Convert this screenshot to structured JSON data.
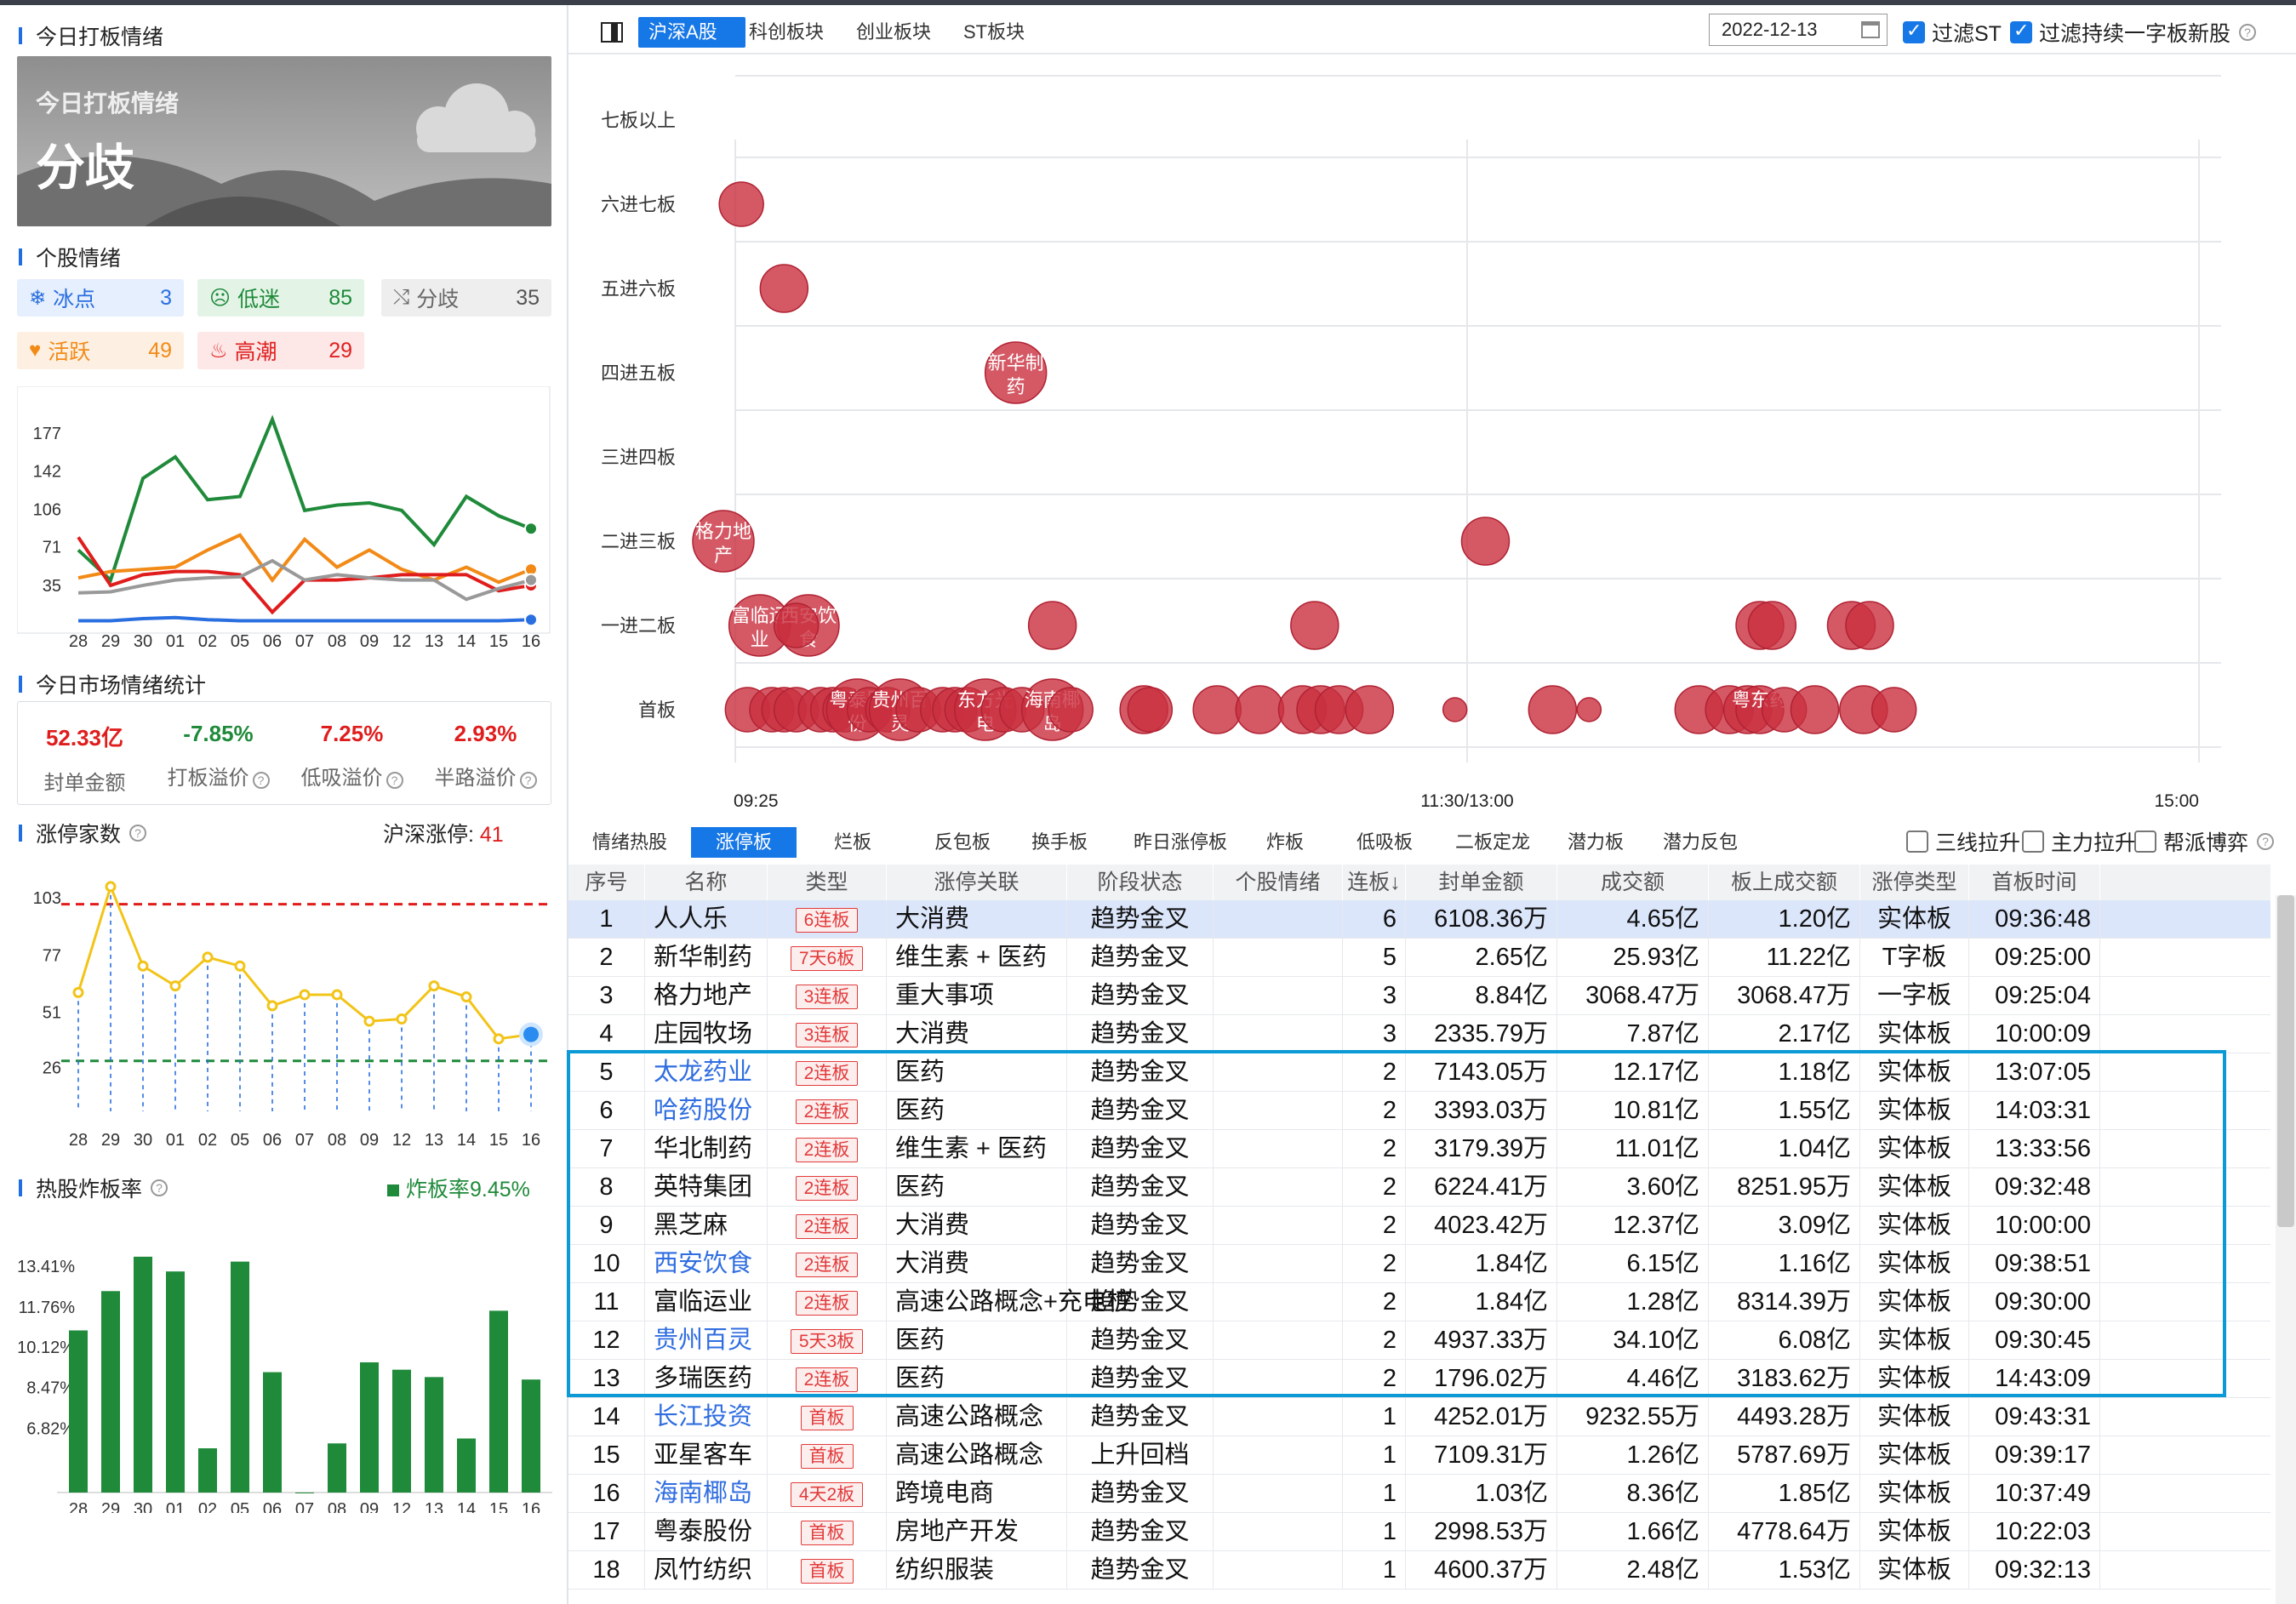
{
  "left": {
    "today_title": "今日打板情绪",
    "banner": {
      "subtitle": "今日打板情绪",
      "mood": "分歧"
    },
    "stock_mood_title": "个股情绪",
    "chips": [
      {
        "name": "冰点",
        "value": "3",
        "color": "#2a6fe0",
        "bg": "#e6effd",
        "icon": "snowflake-icon",
        "glyph": "❄"
      },
      {
        "name": "低迷",
        "value": "85",
        "color": "#1f8a3a",
        "bg": "#e3f4e7",
        "icon": "sad-face-icon",
        "glyph": "☹"
      },
      {
        "name": "分歧",
        "value": "35",
        "color": "#666",
        "bg": "#eeeeee",
        "icon": "share-icon",
        "glyph": "⤭"
      },
      {
        "name": "活跃",
        "value": "49",
        "color": "#f28a17",
        "bg": "#fdf0e2",
        "icon": "heart-icon",
        "glyph": "♥"
      },
      {
        "name": "高潮",
        "value": "29",
        "color": "#e02020",
        "bg": "#fde7e7",
        "icon": "fire-icon",
        "glyph": "♨"
      }
    ],
    "market_stats_title": "今日市场情绪统计",
    "stats": [
      {
        "value": "52.33亿",
        "label": "封单金额",
        "color": "#e01d1d",
        "hint": false
      },
      {
        "value": "-7.85%",
        "label": "打板溢价",
        "color": "#1f8a3a",
        "hint": true
      },
      {
        "value": "7.25%",
        "label": "低吸溢价",
        "color": "#e01d1d",
        "hint": true
      },
      {
        "value": "2.93%",
        "label": "半路溢价",
        "color": "#e01d1d",
        "hint": true
      }
    ],
    "limitup_title": "涨停家数",
    "limitup_right_label": "沪深涨停:",
    "limitup_right_value": "41",
    "bomb_title": "热股炸板率",
    "bomb_legend": "炸板率9.45%"
  },
  "right": {
    "tabs": [
      "沪深A股",
      "科创板块",
      "创业板块",
      "ST板块"
    ],
    "active_tab": 0,
    "date": "2022-12-13",
    "filters": [
      "过滤ST",
      "过滤持续一字板新股"
    ],
    "sub_tabs": [
      "情绪热股",
      "涨停板",
      "烂板",
      "反包板",
      "换手板",
      "昨日涨停板",
      "炸板",
      "低吸板",
      "二板定龙",
      "潜力板",
      "潜力反包"
    ],
    "active_sub_tab": 1,
    "sub_filters": [
      "三线拉升",
      "主力拉升",
      "帮派博弈"
    ],
    "columns": [
      "序号",
      "名称",
      "类型",
      "涨停关联",
      "阶段状态",
      "个股情绪",
      "连板↓",
      "封单金额",
      "成交额",
      "板上成交额",
      "涨停类型",
      "首板时间"
    ],
    "rows": [
      {
        "idx": "1",
        "name": "人人乐",
        "type": "6连板",
        "assoc": "大消费",
        "stage": "趋势金叉",
        "mood": "",
        "lb": "6",
        "seal": "6108.36万",
        "amount": "4.65亿",
        "board_amt": "1.20亿",
        "kind": "实体板",
        "time": "09:36:48",
        "link": false
      },
      {
        "idx": "2",
        "name": "新华制药",
        "type": "7天6板",
        "assoc": "维生素 + 医药",
        "stage": "趋势金叉",
        "mood": "",
        "lb": "5",
        "seal": "2.65亿",
        "amount": "25.93亿",
        "board_amt": "11.22亿",
        "kind": "T字板",
        "time": "09:25:00",
        "link": false
      },
      {
        "idx": "3",
        "name": "格力地产",
        "type": "3连板",
        "assoc": "重大事项",
        "stage": "趋势金叉",
        "mood": "",
        "lb": "3",
        "seal": "8.84亿",
        "amount": "3068.47万",
        "board_amt": "3068.47万",
        "kind": "一字板",
        "time": "09:25:04",
        "link": false
      },
      {
        "idx": "4",
        "name": "庄园牧场",
        "type": "3连板",
        "assoc": "大消费",
        "stage": "趋势金叉",
        "mood": "",
        "lb": "3",
        "seal": "2335.79万",
        "amount": "7.87亿",
        "board_amt": "2.17亿",
        "kind": "实体板",
        "time": "10:00:09",
        "link": false
      },
      {
        "idx": "5",
        "name": "太龙药业",
        "type": "2连板",
        "assoc": "医药",
        "stage": "趋势金叉",
        "mood": "",
        "lb": "2",
        "seal": "7143.05万",
        "amount": "12.17亿",
        "board_amt": "1.18亿",
        "kind": "实体板",
        "time": "13:07:05",
        "link": true
      },
      {
        "idx": "6",
        "name": "哈药股份",
        "type": "2连板",
        "assoc": "医药",
        "stage": "趋势金叉",
        "mood": "",
        "lb": "2",
        "seal": "3393.03万",
        "amount": "10.81亿",
        "board_amt": "1.55亿",
        "kind": "实体板",
        "time": "14:03:31",
        "link": true
      },
      {
        "idx": "7",
        "name": "华北制药",
        "type": "2连板",
        "assoc": "维生素 + 医药",
        "stage": "趋势金叉",
        "mood": "",
        "lb": "2",
        "seal": "3179.39万",
        "amount": "11.01亿",
        "board_amt": "1.04亿",
        "kind": "实体板",
        "time": "13:33:56",
        "link": false
      },
      {
        "idx": "8",
        "name": "英特集团",
        "type": "2连板",
        "assoc": "医药",
        "stage": "趋势金叉",
        "mood": "",
        "lb": "2",
        "seal": "6224.41万",
        "amount": "3.60亿",
        "board_amt": "8251.95万",
        "kind": "实体板",
        "time": "09:32:48",
        "link": false
      },
      {
        "idx": "9",
        "name": "黑芝麻",
        "type": "2连板",
        "assoc": "大消费",
        "stage": "趋势金叉",
        "mood": "",
        "lb": "2",
        "seal": "4023.42万",
        "amount": "12.37亿",
        "board_amt": "3.09亿",
        "kind": "实体板",
        "time": "10:00:00",
        "link": false
      },
      {
        "idx": "10",
        "name": "西安饮食",
        "type": "2连板",
        "assoc": "大消费",
        "stage": "趋势金叉",
        "mood": "",
        "lb": "2",
        "seal": "1.84亿",
        "amount": "6.15亿",
        "board_amt": "1.16亿",
        "kind": "实体板",
        "time": "09:38:51",
        "link": true
      },
      {
        "idx": "11",
        "name": "富临运业",
        "type": "2连板",
        "assoc": "高速公路概念+充电桩",
        "stage": "趋势金叉",
        "mood": "",
        "lb": "2",
        "seal": "1.84亿",
        "amount": "1.28亿",
        "board_amt": "8314.39万",
        "kind": "实体板",
        "time": "09:30:00",
        "link": false
      },
      {
        "idx": "12",
        "name": "贵州百灵",
        "type": "5天3板",
        "assoc": "医药",
        "stage": "趋势金叉",
        "mood": "",
        "lb": "2",
        "seal": "4937.33万",
        "amount": "34.10亿",
        "board_amt": "6.08亿",
        "kind": "实体板",
        "time": "09:30:45",
        "link": true
      },
      {
        "idx": "13",
        "name": "多瑞医药",
        "type": "2连板",
        "assoc": "医药",
        "stage": "趋势金叉",
        "mood": "",
        "lb": "2",
        "seal": "1796.02万",
        "amount": "4.46亿",
        "board_amt": "3183.62万",
        "kind": "实体板",
        "time": "14:43:09",
        "link": false
      },
      {
        "idx": "14",
        "name": "长江投资",
        "type": "首板",
        "assoc": "高速公路概念",
        "stage": "趋势金叉",
        "mood": "",
        "lb": "1",
        "seal": "4252.01万",
        "amount": "9232.55万",
        "board_amt": "4493.28万",
        "kind": "实体板",
        "time": "09:43:31",
        "link": true
      },
      {
        "idx": "15",
        "name": "亚星客车",
        "type": "首板",
        "assoc": "高速公路概念",
        "stage": "上升回档",
        "mood": "",
        "lb": "1",
        "seal": "7109.31万",
        "amount": "1.26亿",
        "board_amt": "5787.69万",
        "kind": "实体板",
        "time": "09:39:17",
        "link": false
      },
      {
        "idx": "16",
        "name": "海南椰岛",
        "type": "4天2板",
        "assoc": "跨境电商",
        "stage": "趋势金叉",
        "mood": "",
        "lb": "1",
        "seal": "1.03亿",
        "amount": "8.36亿",
        "board_amt": "1.85亿",
        "kind": "实体板",
        "time": "10:37:49",
        "link": true
      },
      {
        "idx": "17",
        "name": "粤泰股份",
        "type": "首板",
        "assoc": "房地产开发",
        "stage": "趋势金叉",
        "mood": "",
        "lb": "1",
        "seal": "2998.53万",
        "amount": "1.66亿",
        "board_amt": "4778.64万",
        "kind": "实体板",
        "time": "10:22:03",
        "link": false
      },
      {
        "idx": "18",
        "name": "凤竹纺织",
        "type": "首板",
        "assoc": "纺织服装",
        "stage": "趋势金叉",
        "mood": "",
        "lb": "1",
        "seal": "4600.37万",
        "amount": "2.48亿",
        "board_amt": "1.53亿",
        "kind": "实体板",
        "time": "09:32:13",
        "link": false
      }
    ]
  },
  "chart_data": [
    {
      "type": "line",
      "categories": [
        "28",
        "29",
        "30",
        "01",
        "02",
        "05",
        "06",
        "07",
        "08",
        "09",
        "12",
        "13",
        "14",
        "15",
        "16"
      ],
      "y_ticks": [
        "35",
        "71",
        "106",
        "142",
        "177"
      ],
      "ylim": [
        0,
        205
      ],
      "series": [
        {
          "color": "#1f8a3a",
          "values": [
            68,
            40,
            135,
            155,
            115,
            118,
            190,
            105,
            110,
            112,
            105,
            73,
            118,
            100,
            88
          ]
        },
        {
          "color": "#f28a17",
          "values": [
            42,
            48,
            50,
            52,
            68,
            82,
            40,
            78,
            52,
            68,
            50,
            40,
            52,
            38,
            50
          ]
        },
        {
          "color": "#e01d1d",
          "values": [
            80,
            35,
            45,
            48,
            48,
            45,
            10,
            40,
            40,
            42,
            45,
            45,
            45,
            30,
            35
          ]
        },
        {
          "color": "#999999",
          "values": [
            28,
            29,
            35,
            40,
            42,
            43,
            58,
            40,
            45,
            42,
            40,
            40,
            22,
            32,
            40
          ]
        },
        {
          "color": "#2a6fe0",
          "values": [
            2,
            2,
            4,
            5,
            3,
            2,
            2,
            2,
            2,
            2,
            2,
            2,
            2,
            2,
            3
          ]
        }
      ]
    },
    {
      "type": "line",
      "categories": [
        "28",
        "29",
        "30",
        "01",
        "02",
        "05",
        "06",
        "07",
        "08",
        "09",
        "12",
        "13",
        "14",
        "15",
        "16"
      ],
      "y_ticks": [
        "26",
        "51",
        "77",
        "103"
      ],
      "ylim": [
        10,
        118
      ],
      "ref_lines": [
        {
          "y": 100,
          "color": "#e01d1d"
        },
        {
          "y": 29,
          "color": "#1f8a3a"
        }
      ],
      "series": [
        {
          "color": "#f2c418",
          "values": [
            60,
            108,
            72,
            63,
            76,
            72,
            54,
            59,
            59,
            47,
            48,
            63,
            58,
            39,
            41
          ]
        }
      ]
    },
    {
      "type": "bar",
      "categories": [
        "28",
        "29",
        "30",
        "01",
        "02",
        "05",
        "06",
        "07",
        "08",
        "09",
        "12",
        "13",
        "14",
        "15",
        "16"
      ],
      "y_ticks": [
        "6.82%",
        "8.47%",
        "10.12%",
        "11.76%",
        "13.41%"
      ],
      "ylim": [
        4.2,
        14.8
      ],
      "color": "#1f8a3a",
      "values": [
        10.8,
        12.4,
        13.8,
        13.2,
        6.0,
        13.6,
        9.1,
        4.2,
        6.2,
        9.5,
        9.2,
        8.9,
        6.4,
        11.6,
        8.8
      ]
    },
    {
      "type": "scatter",
      "y_categories": [
        "首板",
        "一进二板",
        "二进三板",
        "三进四板",
        "四进五板",
        "五进六板",
        "六进七板",
        "七板以上"
      ],
      "x_ticks": [
        "09:25",
        "11:30/13:00",
        "15:00"
      ],
      "xlim": [
        0,
        240
      ],
      "points": [
        {
          "x": 1,
          "y": 6,
          "label": "",
          "r": 26
        },
        {
          "x": 2,
          "y": 0,
          "label": "",
          "r": 26
        },
        {
          "x": 4,
          "y": 1,
          "label": "富临运业",
          "r": 36
        },
        {
          "x": 6,
          "y": 0,
          "label": "",
          "r": 26
        },
        {
          "x": 8,
          "y": 0,
          "label": "",
          "r": 26
        },
        {
          "x": 10,
          "y": 0,
          "label": "",
          "r": 26
        },
        {
          "x": 12,
          "y": 1,
          "label": "西安饮食",
          "r": 36
        },
        {
          "x": 14,
          "y": 0,
          "label": "",
          "r": 26
        },
        {
          "x": 16,
          "y": 0,
          "label": "",
          "r": 26
        },
        {
          "x": 18,
          "y": 0,
          "label": "",
          "r": 26
        },
        {
          "x": 20,
          "y": 0,
          "label": "粤泰股份",
          "r": 36
        },
        {
          "x": 22,
          "y": 0,
          "label": "",
          "r": 26
        },
        {
          "x": 25,
          "y": 0,
          "label": "",
          "r": 26
        },
        {
          "x": 27,
          "y": 0,
          "label": "贵州百灵",
          "r": 36
        },
        {
          "x": 30,
          "y": 0,
          "label": "",
          "r": 26
        },
        {
          "x": 34,
          "y": 0,
          "label": "",
          "r": 26
        },
        {
          "x": 36,
          "y": 0,
          "label": "",
          "r": 26
        },
        {
          "x": 38,
          "y": 0,
          "label": "",
          "r": 26
        },
        {
          "x": 41,
          "y": 0,
          "label": "东方光电",
          "r": 36
        },
        {
          "x": 44,
          "y": 0,
          "label": "",
          "r": 26
        },
        {
          "x": 47,
          "y": 0,
          "label": "",
          "r": 26
        },
        {
          "x": 52,
          "y": 0,
          "label": "海南椰岛",
          "r": 36
        },
        {
          "x": 55,
          "y": 0,
          "label": "",
          "r": 26
        },
        {
          "x": 67,
          "y": 0,
          "label": "",
          "r": 28
        },
        {
          "x": 68,
          "y": 0,
          "label": "",
          "r": 26
        },
        {
          "x": 79,
          "y": 0,
          "label": "",
          "r": 28
        },
        {
          "x": 86,
          "y": 0,
          "label": "",
          "r": 28
        },
        {
          "x": 93,
          "y": 0,
          "label": "",
          "r": 28
        },
        {
          "x": 96,
          "y": 0,
          "label": "",
          "r": 28
        },
        {
          "x": 99,
          "y": 0,
          "label": "",
          "r": 28
        },
        {
          "x": 104,
          "y": 0,
          "label": "",
          "r": 28
        },
        {
          "x": 118,
          "y": 0,
          "label": "",
          "r": 14
        },
        {
          "x": 134,
          "y": 0,
          "label": "",
          "r": 28
        },
        {
          "x": 140,
          "y": 0,
          "label": "",
          "r": 14
        },
        {
          "x": 158,
          "y": 0,
          "label": "",
          "r": 28
        },
        {
          "x": 163,
          "y": 0,
          "label": "",
          "r": 28
        },
        {
          "x": 166,
          "y": 0,
          "label": "",
          "r": 28
        },
        {
          "x": 168,
          "y": 0,
          "label": "粤东药",
          "r": 28
        },
        {
          "x": 172,
          "y": 0,
          "label": "",
          "r": 26
        },
        {
          "x": 177,
          "y": 0,
          "label": "",
          "r": 28
        },
        {
          "x": 185,
          "y": 0,
          "label": "",
          "r": 28
        },
        {
          "x": 190,
          "y": 0,
          "label": "",
          "r": 26
        },
        {
          "x": 10,
          "y": 1,
          "label": "",
          "r": 26
        },
        {
          "x": 52,
          "y": 1,
          "label": "",
          "r": 28
        },
        {
          "x": 95,
          "y": 1,
          "label": "",
          "r": 28
        },
        {
          "x": 168,
          "y": 1,
          "label": "",
          "r": 28
        },
        {
          "x": 170,
          "y": 1,
          "label": "",
          "r": 28
        },
        {
          "x": 183,
          "y": 1,
          "label": "",
          "r": 28
        },
        {
          "x": 186,
          "y": 1,
          "label": "",
          "r": 28
        },
        {
          "x": 0,
          "y": 2,
          "label": "格力地产",
          "r": 36
        },
        {
          "x": 123,
          "y": 2,
          "label": "",
          "r": 28
        },
        {
          "x": 46,
          "y": 4,
          "label": "新华制药",
          "r": 36
        },
        {
          "x": 8,
          "y": 5,
          "label": "",
          "r": 28
        }
      ]
    }
  ]
}
